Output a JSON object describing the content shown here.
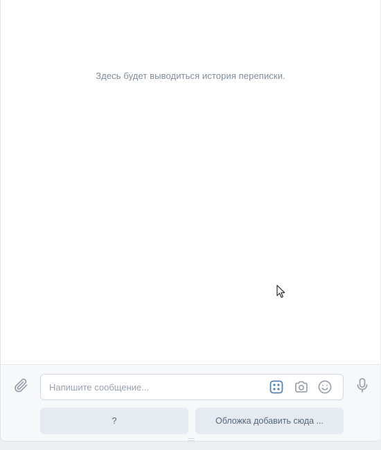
{
  "history": {
    "empty_text": "Здесь будет выводиться история переписки."
  },
  "composer": {
    "input_placeholder": "Напишите сообщение...",
    "input_value": "",
    "icons": {
      "attach": "paperclip-icon",
      "keyboard": "bot-keyboard-icon",
      "camera": "camera-icon",
      "emoji": "smile-icon",
      "microphone": "microphone-icon"
    }
  },
  "keyboard_buttons": [
    {
      "label": "?"
    },
    {
      "label": "Обложка добавить сюда ..."
    }
  ],
  "colors": {
    "accent": "#5181b8",
    "icon_gray": "#99a2ad",
    "button_bg": "#e5ebf1",
    "button_text": "#55677d",
    "muted_text": "#818c99"
  }
}
